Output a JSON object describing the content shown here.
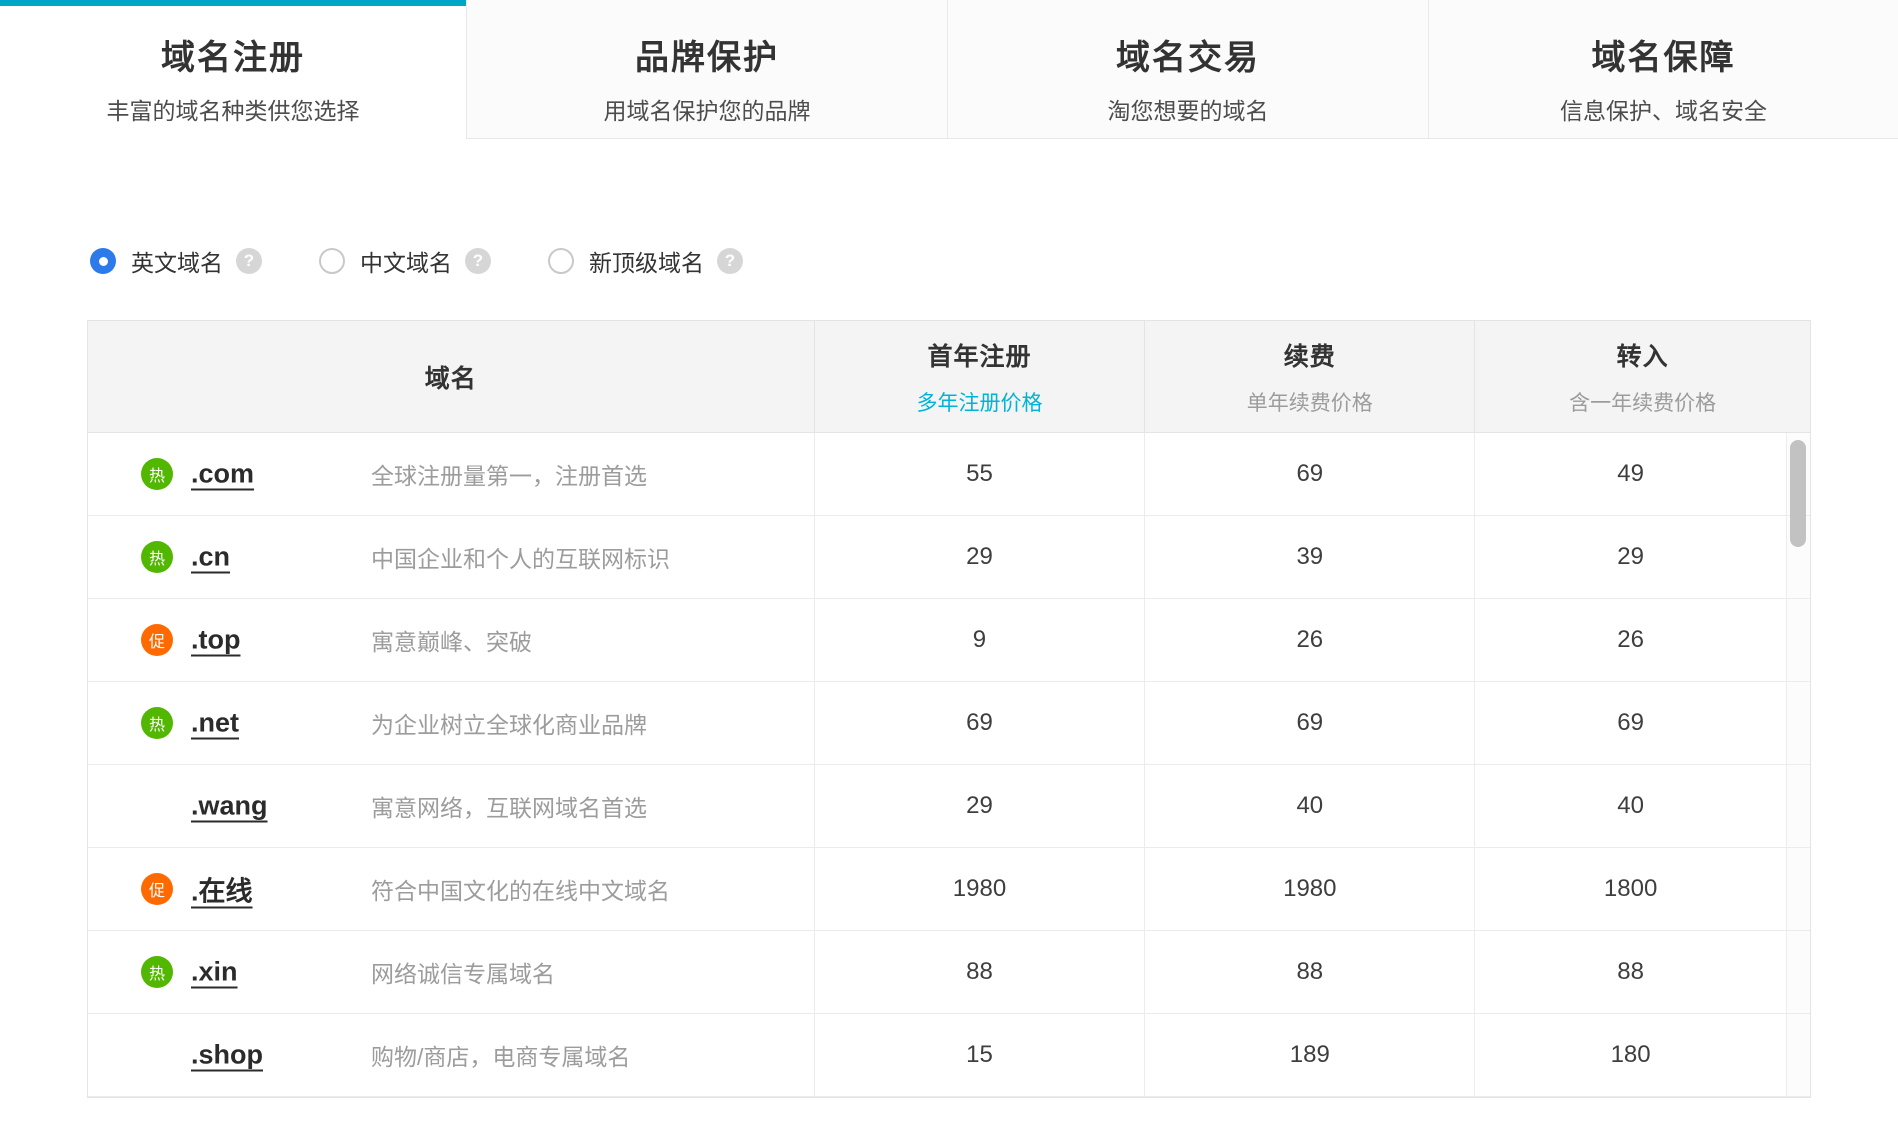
{
  "tabs": [
    {
      "title": "域名注册",
      "subtitle": "丰富的域名种类供您选择",
      "active": true
    },
    {
      "title": "品牌保护",
      "subtitle": "用域名保护您的品牌",
      "active": false
    },
    {
      "title": "域名交易",
      "subtitle": "淘您想要的域名",
      "active": false
    },
    {
      "title": "域名保障",
      "subtitle": "信息保护、域名安全",
      "active": false
    }
  ],
  "filters": [
    {
      "label": "英文域名",
      "selected": true
    },
    {
      "label": "中文域名",
      "selected": false
    },
    {
      "label": "新顶级域名",
      "selected": false
    }
  ],
  "table": {
    "headers": {
      "domain": "域名",
      "register_title": "首年注册",
      "register_sub": "多年注册价格",
      "renew_title": "续费",
      "renew_sub": "单年续费价格",
      "transfer_title": "转入",
      "transfer_sub": "含一年续费价格"
    },
    "rows": [
      {
        "badge": "热",
        "badge_type": "hot",
        "domain": ".com",
        "desc": "全球注册量第一，注册首选",
        "register": "55",
        "renew": "69",
        "transfer": "49"
      },
      {
        "badge": "热",
        "badge_type": "hot",
        "domain": ".cn",
        "desc": "中国企业和个人的互联网标识",
        "register": "29",
        "renew": "39",
        "transfer": "29"
      },
      {
        "badge": "促",
        "badge_type": "promo",
        "domain": ".top",
        "desc": "寓意巅峰、突破",
        "register": "9",
        "renew": "26",
        "transfer": "26"
      },
      {
        "badge": "热",
        "badge_type": "hot",
        "domain": ".net",
        "desc": "为企业树立全球化商业品牌",
        "register": "69",
        "renew": "69",
        "transfer": "69"
      },
      {
        "badge": "",
        "badge_type": "none",
        "domain": ".wang",
        "desc": "寓意网络，互联网域名首选",
        "register": "29",
        "renew": "40",
        "transfer": "40"
      },
      {
        "badge": "促",
        "badge_type": "promo",
        "domain": ".在线",
        "desc": "符合中国文化的在线中文域名",
        "register": "1980",
        "renew": "1980",
        "transfer": "1800"
      },
      {
        "badge": "热",
        "badge_type": "hot",
        "domain": ".xin",
        "desc": "网络诚信专属域名",
        "register": "88",
        "renew": "88",
        "transfer": "88"
      },
      {
        "badge": "",
        "badge_type": "none",
        "domain": ".shop",
        "desc": "购物/商店，电商专属域名",
        "register": "15",
        "renew": "189",
        "transfer": "180"
      }
    ]
  },
  "colors": {
    "accent_cyan": "#00a6c7",
    "link_cyan": "#00b3d8",
    "badge_hot_green": "#52b700",
    "badge_promo_orange": "#ff6a00",
    "radio_blue": "#2d7bea"
  }
}
